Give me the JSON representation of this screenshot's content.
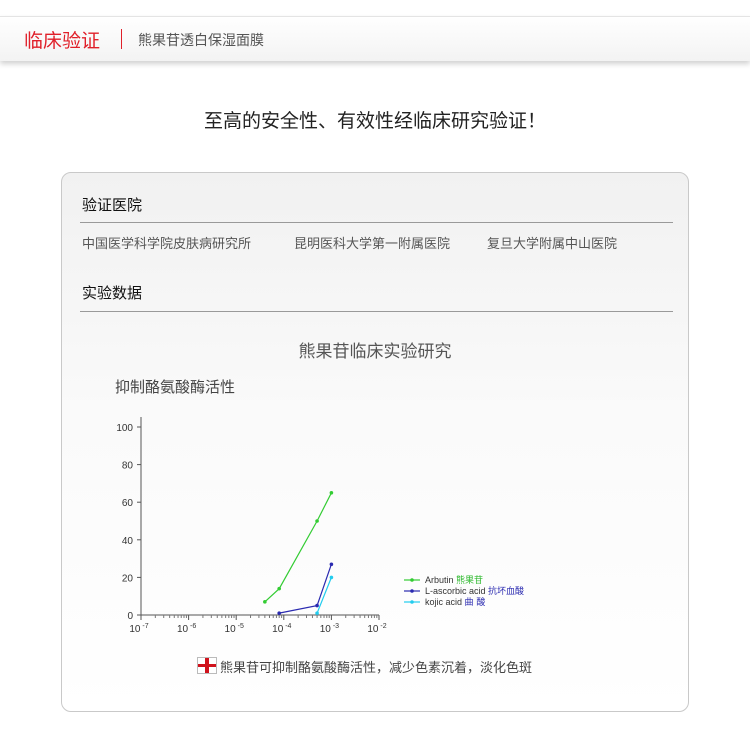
{
  "header": {
    "title": "临床验证",
    "subtitle": "熊果苷透白保湿面膜"
  },
  "headline": "至高的安全性、有效性经临床研究验证！",
  "section1": {
    "title": "验证医院",
    "hospitals": [
      "中国医学科学院皮肤病研究所",
      "昆明医科大学第一附属医院",
      "复旦大学附属中山医院"
    ]
  },
  "section2": {
    "title": "实验数据"
  },
  "chart_data": {
    "type": "line",
    "title": "熊果苷临床实验研究",
    "ylabel": "抑制酪氨酸酶活性",
    "xscale": "log",
    "xlim": [
      1e-07,
      0.01
    ],
    "ylim": [
      0,
      100
    ],
    "yticks": [
      "0",
      "20",
      "40",
      "60",
      "80",
      "100"
    ],
    "xticks": [
      {
        "base": "10",
        "exp": "-7"
      },
      {
        "base": "10",
        "exp": "-6"
      },
      {
        "base": "10",
        "exp": "-5"
      },
      {
        "base": "10",
        "exp": "-4"
      },
      {
        "base": "10",
        "exp": "-3"
      },
      {
        "base": "10",
        "exp": "-2"
      }
    ],
    "legend_position": "right",
    "series": [
      {
        "name": "Arbutin",
        "name_cn": "熊果苷",
        "color": "#33cc33",
        "label_color": "#33bb33",
        "x": [
          4e-05,
          8e-05,
          0.0005,
          0.001
        ],
        "y": [
          7,
          14,
          50,
          65
        ]
      },
      {
        "name": "L-ascorbic acid",
        "name_cn": "抗坏血酸",
        "color": "#2a2ab0",
        "label_color": "#2a2ab0",
        "x": [
          8e-05,
          0.0005,
          0.001
        ],
        "y": [
          1,
          5,
          27
        ]
      },
      {
        "name": "kojic acid",
        "name_cn": "曲 酸",
        "color": "#22ccee",
        "label_color": "#2a2ab0",
        "x": [
          0.0005,
          0.001
        ],
        "y": [
          1,
          20
        ]
      }
    ]
  },
  "caption": "熊果苷可抑制酪氨酸酶活性，减少色素沉着，淡化色斑",
  "colors": {
    "brand_red": "#e0202a"
  }
}
